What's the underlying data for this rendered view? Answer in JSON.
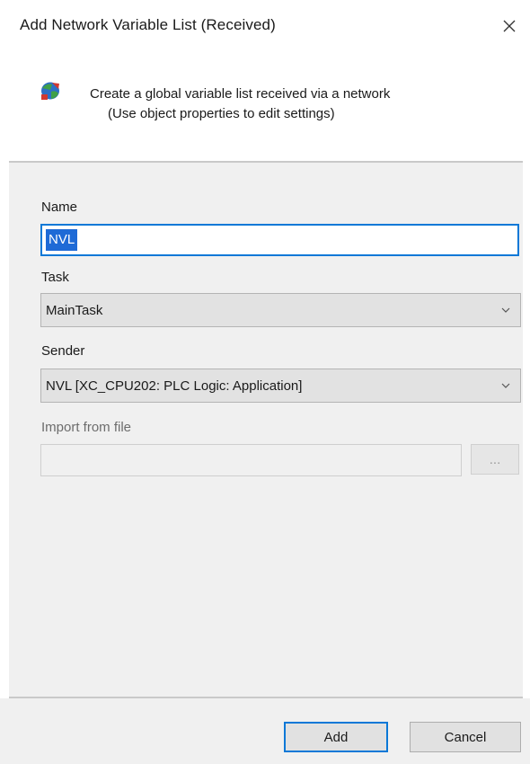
{
  "window": {
    "title": "Add Network Variable List (Received)",
    "close_icon": "close-icon"
  },
  "header": {
    "icon": "network-variable-list-icon",
    "line1": "Create a global variable list received via a network",
    "line2": "(Use object properties to edit settings)"
  },
  "form": {
    "name": {
      "label": "Name",
      "value": "NVL",
      "selected": true
    },
    "task": {
      "label": "Task",
      "value": "MainTask"
    },
    "sender": {
      "label": "Sender",
      "value": "NVL [XC_CPU202: PLC Logic: Application]"
    },
    "import": {
      "label": "Import from file",
      "value": "",
      "enabled": false,
      "browse_label": "..."
    }
  },
  "buttons": {
    "add": "Add",
    "cancel": "Cancel"
  },
  "colors": {
    "accent": "#0a78d7",
    "selection": "#1e6ad6",
    "panel": "#f0f0f0"
  }
}
